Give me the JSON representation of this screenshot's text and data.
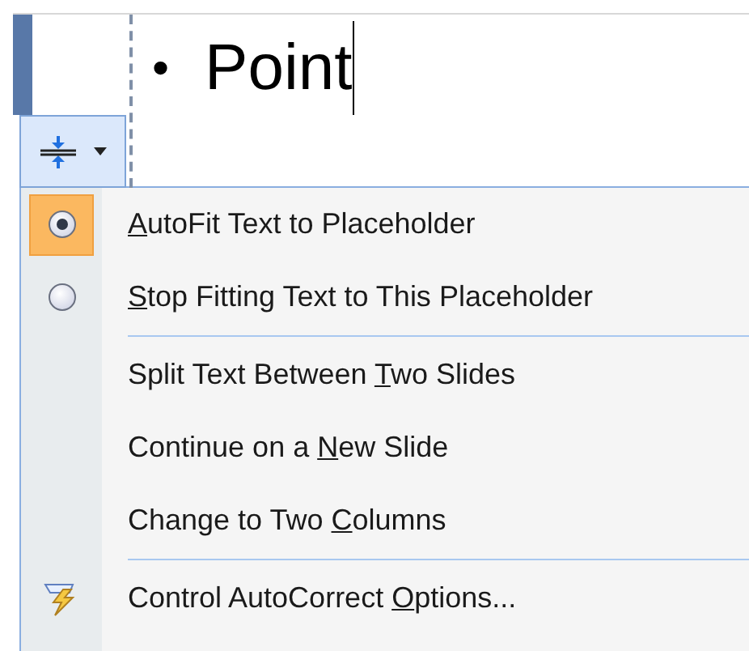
{
  "slide": {
    "bullet": "•",
    "text": "Point"
  },
  "menu": {
    "groups": [
      {
        "items": [
          {
            "kind": "radio",
            "selected": true,
            "key": "A",
            "after": "utoFit Text to Placeholder"
          },
          {
            "kind": "radio",
            "selected": false,
            "key": "S",
            "after": "top Fitting Text to This Placeholder"
          }
        ]
      },
      {
        "items": [
          {
            "kind": "command",
            "before": "Split Text Between ",
            "key": "T",
            "after": "wo Slides"
          },
          {
            "kind": "command",
            "before": "Continue on a ",
            "key": "N",
            "after": "ew Slide"
          },
          {
            "kind": "command",
            "before": "Change to Two ",
            "key": "C",
            "after": "olumns"
          }
        ]
      },
      {
        "items": [
          {
            "kind": "autocorrect",
            "before": "Control AutoCorrect ",
            "key": "O",
            "after": "ptions..."
          }
        ]
      }
    ]
  }
}
